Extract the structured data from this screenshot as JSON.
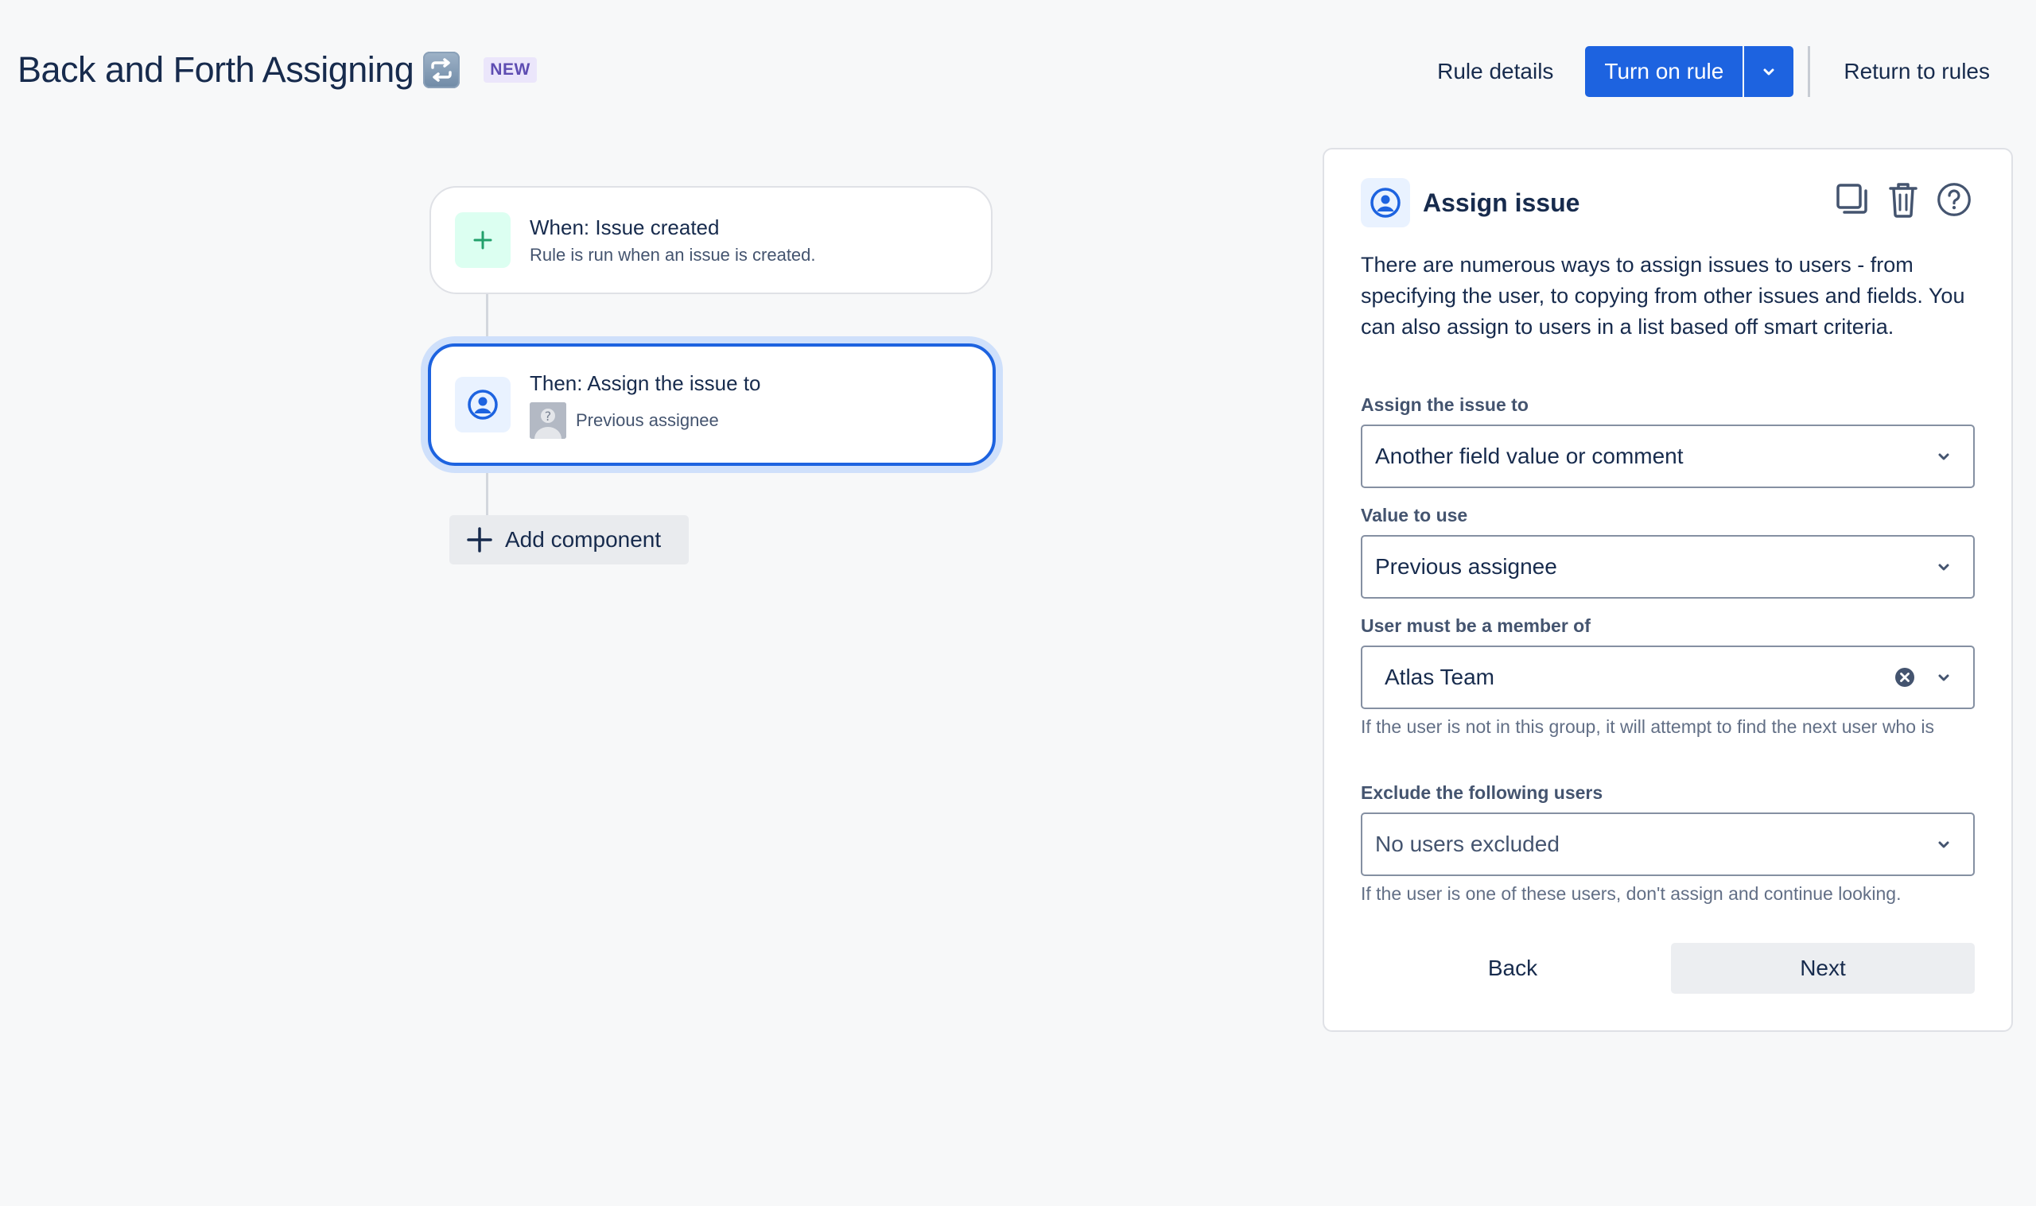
{
  "header": {
    "title": "Back and Forth Assigning",
    "title_emoji": "repeat-icon",
    "badge": "NEW",
    "rule_details": "Rule details",
    "turn_on_rule": "Turn on rule",
    "return_to_rules": "Return to rules"
  },
  "flow": {
    "trigger": {
      "title": "When: Issue created",
      "subtitle": "Rule is run when an issue is created.",
      "icon": "plus-icon"
    },
    "action": {
      "title": "Then: Assign the issue to",
      "subtitle": "Previous assignee",
      "icon": "user-circle-icon"
    },
    "add_component": "Add component"
  },
  "panel": {
    "title": "Assign issue",
    "description": "There are numerous ways to assign issues to users - from specifying the user, to copying from other issues and fields. You can also assign to users in a list based off smart criteria.",
    "fields": {
      "assign_to": {
        "label": "Assign the issue to",
        "value": "Another field value or comment"
      },
      "value_to_use": {
        "label": "Value to use",
        "value": "Previous assignee"
      },
      "member_of": {
        "label": "User must be a member of",
        "value": "Atlas Team",
        "helper": "If the user is not in this group, it will attempt to find the next user who is"
      },
      "exclude": {
        "label": "Exclude the following users",
        "placeholder": "No users excluded",
        "helper": "If the user is one of these users, don't assign and continue looking."
      }
    },
    "back": "Back",
    "next": "Next"
  },
  "colors": {
    "primary": "#1d63e0",
    "selected_glow": "#cfe0fb",
    "trigger_icon_bg": "#dcfff1",
    "trigger_icon": "#22a06b",
    "badge_bg": "#ebe6fb",
    "badge_text": "#5e4db2"
  }
}
